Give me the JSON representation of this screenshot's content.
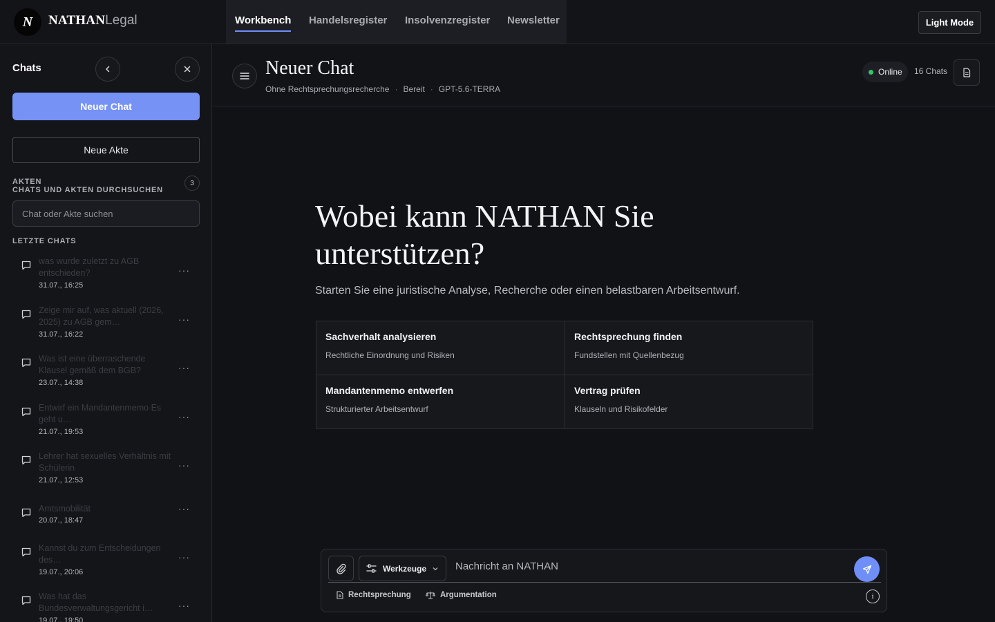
{
  "app": {
    "logo_letter": "N",
    "brand_bold": "NATHAN",
    "brand_light": "Legal",
    "light_mode_label": "Light Mode"
  },
  "nav": {
    "items": [
      {
        "label": "Workbench",
        "active": true
      },
      {
        "label": "Handelsregister",
        "active": false
      },
      {
        "label": "Insolvenzregister",
        "active": false
      },
      {
        "label": "Newsletter",
        "active": false
      }
    ]
  },
  "sidebar": {
    "title": "Chats",
    "new_chat_label": "Neuer Chat",
    "new_file_label": "Neue Akte",
    "akten_label": "AKTEN",
    "search_label": "CHATS UND AKTEN DURCHSUCHEN",
    "akten_count": "3",
    "search_placeholder": "Chat oder Akte suchen",
    "recent_label": "LETZTE CHATS",
    "chats": [
      {
        "title": "was wurde zuletzt zu AGB entschieden?",
        "date": "31.07., 16:25"
      },
      {
        "title": "Zeige mir auf, was aktuell (2026, 2025) zu AGB gem…",
        "date": "31.07., 16:22"
      },
      {
        "title": "Was ist eine überraschende Klausel gemäß dem BGB?",
        "date": "23.07., 14:38"
      },
      {
        "title": "Entwirf ein Mandantenmemo Es geht u…",
        "date": "21.07., 19:53"
      },
      {
        "title": "Lehrer hat sexuelles Verhältnis mit Schülerin",
        "date": "21.07., 12:53"
      },
      {
        "title": "Amtsmobilität",
        "date": "20.07., 18:47"
      },
      {
        "title": "Kannst du zum Entscheidungen des…",
        "date": "19.07., 20:06"
      },
      {
        "title": "Was hat das Bundesverwaltungsgericht i…",
        "date": "19.07., 19:50"
      }
    ]
  },
  "chat": {
    "title": "Neuer Chat",
    "meta": [
      "Ohne Rechtsprechungsrecherche",
      "Bereit",
      "GPT-5.6-TERRA"
    ],
    "meta_sep": "·",
    "status": "Online",
    "chats_count": "16 Chats"
  },
  "hero": {
    "title": "Wobei kann NATHAN Sie unterstützen?",
    "subtitle": "Starten Sie eine juristische Analyse, Recherche oder einen belastbaren Arbeitsentwurf."
  },
  "cards": [
    {
      "title": "Sachverhalt analysieren",
      "subtitle": "Rechtliche Einordnung und Risiken"
    },
    {
      "title": "Rechtsprechung finden",
      "subtitle": "Fundstellen mit Quellenbezug"
    },
    {
      "title": "Mandantenmemo entwerfen",
      "subtitle": "Strukturierter Arbeitsentwurf"
    },
    {
      "title": "Vertrag prüfen",
      "subtitle": "Klauseln und Risikofelder"
    }
  ],
  "composer": {
    "tools_label": "Werkzeuge",
    "placeholder": "Nachricht an NATHAN",
    "chip_rechtsprechung": "Rechtsprechung",
    "chip_argumentation": "Argumentation",
    "info_glyph": "i"
  },
  "colors": {
    "accent": "#7592f4",
    "online": "#35c56a",
    "background": "#111216"
  }
}
